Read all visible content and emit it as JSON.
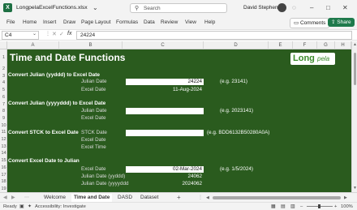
{
  "window": {
    "filename": "LongpelaExcelFunctions.xlsx",
    "search_placeholder": "Search",
    "user_name": "David Stephens"
  },
  "ribbon": {
    "tabs": [
      "File",
      "Home",
      "Insert",
      "Draw",
      "Page Layout",
      "Formulas",
      "Data",
      "Review",
      "View",
      "Help"
    ],
    "comments_label": "Comments",
    "share_label": "Share"
  },
  "formula_bar": {
    "name_box": "C4",
    "fx": "fx",
    "value": "24224"
  },
  "columns": [
    "A",
    "B",
    "C",
    "D",
    "E",
    "F",
    "G",
    "H"
  ],
  "rows": [
    "1",
    "2",
    "3",
    "4",
    "5",
    "6",
    "7",
    "8",
    "9",
    "10",
    "11",
    "12",
    "13",
    "14",
    "15",
    "16",
    "17",
    "18",
    "19"
  ],
  "sheet": {
    "title": "Time and Date Functions",
    "logo_main": "Long",
    "logo_italic": "pela",
    "sections": {
      "julian5": "Convert Julian (yyddd) to Excel Date",
      "julian7": "Convert Julian (yyyyddd) to Excel Date",
      "stck": "Convert STCK to Excel Date",
      "excel_to_julian": "Convert Excel Date to Julian"
    },
    "julian5": {
      "label1": "Julian Date",
      "value1": "24224",
      "eg": "(e.g. 23141)",
      "label2": "Excel Date",
      "value2": "11-Aug-2024"
    },
    "julian7": {
      "label1": "Julian Date",
      "eg": "(e.g. 2023141)",
      "label2": "Excel Date"
    },
    "stck": {
      "label1": "STCK Date",
      "eg": "(e.g. BDD6132B50280A0A)",
      "label2": "Excel Date",
      "label3": "Excel Time"
    },
    "excel_to_julian": {
      "label1": "Excel Date",
      "value1": "02-Mar-2024",
      "eg": "(e.g. 1/5/2024)",
      "label2": "Julian Date (yyddd)",
      "value2": "24062",
      "label3": "Julian Date (yyyyddd",
      "value3": "2024062"
    }
  },
  "sheet_tabs": [
    "Welcome",
    "Time and Date",
    "DASD",
    "Dataset"
  ],
  "active_tab": "Time and Date",
  "add_sheet": "+",
  "status": {
    "ready": "Ready",
    "accessibility": "Accessibility: Investigate",
    "zoom": "100%"
  },
  "colors": {
    "sheet_bg": "#2a5b1e",
    "excel_green": "#1f7a4c",
    "logo_green": "#3a8a2a"
  }
}
